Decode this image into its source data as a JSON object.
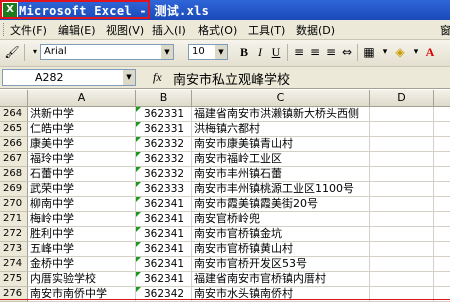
{
  "window": {
    "title": "Microsoft Excel - 测试.xls",
    "icon": "excel-app-icon"
  },
  "menu": [
    "文件(F)",
    "编辑(E)",
    "视图(V)",
    "插入(I)",
    "格式(O)",
    "工具(T)",
    "数据(D)",
    "窗"
  ],
  "toolbar": {
    "font_name": "Arial",
    "font_size": "10",
    "bold": "B",
    "italic": "I",
    "underline": "U",
    "icons": [
      "paintbrush-icon",
      "align-left-icon",
      "align-center-icon",
      "align-right-icon",
      "merge-center-icon",
      "percent-icon",
      "comma-icon",
      "decimal-icon",
      "indent-icon",
      "border-icon",
      "fill-color-icon",
      "font-color-icon"
    ]
  },
  "formula_bar": {
    "name_box": "A282",
    "fx": "fx",
    "value": "南安市私立观峰学校"
  },
  "columns": [
    "A",
    "B",
    "C",
    "D"
  ],
  "rows": [
    {
      "num": "264",
      "a": "洪新中学",
      "b": "362331",
      "c": "福建省南安市洪濑镇新大桥头西侧"
    },
    {
      "num": "265",
      "a": "仁皓中学",
      "b": "362331",
      "c": "洪梅镇六都村"
    },
    {
      "num": "266",
      "a": "康美中学",
      "b": "362332",
      "c": "南安市康美镇青山村"
    },
    {
      "num": "267",
      "a": "福玲中学",
      "b": "362332",
      "c": "南安市福岭工业区"
    },
    {
      "num": "268",
      "a": "石蕾中学",
      "b": "362332",
      "c": "南安市丰州镇石蕾"
    },
    {
      "num": "269",
      "a": "武荣中学",
      "b": "362333",
      "c": "南安市丰州镇桃源工业区1100号"
    },
    {
      "num": "270",
      "a": "柳南中学",
      "b": "362341",
      "c": "南安市霞美镇霞美街20号"
    },
    {
      "num": "271",
      "a": "梅岭中学",
      "b": "362341",
      "c": "南安官桥岭兜"
    },
    {
      "num": "272",
      "a": "胜利中学",
      "b": "362341",
      "c": "南安市官桥镇金坑"
    },
    {
      "num": "273",
      "a": "五峰中学",
      "b": "362341",
      "c": "南安市官桥镇黄山村"
    },
    {
      "num": "274",
      "a": "金桥中学",
      "b": "362341",
      "c": "南安市官桥开发区53号"
    },
    {
      "num": "275",
      "a": "内厝实验学校",
      "b": "362341",
      "c": "福建省南安市官桥镇内厝村"
    },
    {
      "num": "276",
      "a": "南安市南侨中学",
      "b": "362342",
      "c": "南安市水头镇南侨村"
    }
  ]
}
